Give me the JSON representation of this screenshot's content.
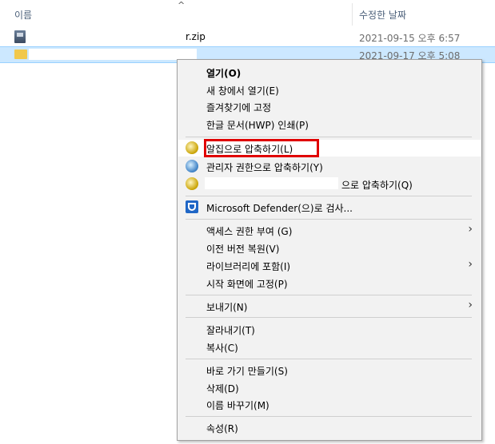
{
  "header": {
    "name_col": "이름",
    "sort_indicator": "^",
    "date_col": "수정한 날짜"
  },
  "files": [
    {
      "name": "r.zip",
      "date": "2021-09-15 오후 6:57",
      "icon": "zip-file-icon"
    },
    {
      "name": "",
      "date": "2021-09-17 오후 5:08",
      "icon": "folder-icon"
    }
  ],
  "menu": {
    "open": "열기(O)",
    "open_new_window": "새 창에서 열기(E)",
    "pin_quick_access": "즐겨찾기에 고정",
    "hancom_pdf": "한글 문서(HWP) 인쇄(P)",
    "alzip_compress": "알집으로 압축하기(L)",
    "admin_compress": "관리자 권한으로 압축하기(Y)",
    "compress_to": "으로 압축하기(Q)",
    "defender_scan": "Microsoft Defender(으)로 검사...",
    "grant_access": "액세스 권한 부여 (G)",
    "restore_versions": "이전 버전 복원(V)",
    "include_library": "라이브러리에 포함(I)",
    "pin_start": "시작 화면에 고정(P)",
    "send_to": "보내기(N)",
    "cut": "잘라내기(T)",
    "copy": "복사(C)",
    "create_shortcut": "바로 가기 만들기(S)",
    "delete": "삭제(D)",
    "rename": "이름 바꾸기(M)",
    "properties": "속성(R)"
  },
  "colors": {
    "selection_bg": "#cce8ff",
    "highlight_border": "#e00000",
    "menu_bg": "#f2f2f2"
  }
}
